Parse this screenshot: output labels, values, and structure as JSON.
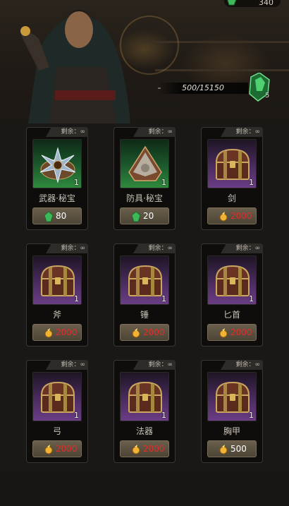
{
  "header": {
    "currency_amount": "340",
    "progress_text": "500/15150",
    "progress_fraction": 0.033,
    "progress_item_count": "5"
  },
  "shop": {
    "items": [
      {
        "remain": "剩余：∞",
        "qty": "1",
        "name": "武器·秘宝",
        "price": "80",
        "currency": "gem",
        "rarity": "green",
        "icon": "weapon-treasure-icon",
        "price_color": "white"
      },
      {
        "remain": "剩余：∞",
        "qty": "1",
        "name": "防具·秘宝",
        "price": "20",
        "currency": "gem",
        "rarity": "green",
        "icon": "armor-treasure-icon",
        "price_color": "white"
      },
      {
        "remain": "剩余：∞",
        "qty": "1",
        "name": "剑",
        "price": "2000",
        "currency": "gold",
        "rarity": "purple",
        "icon": "chest-icon",
        "price_color": "red"
      },
      {
        "remain": "剩余：∞",
        "qty": "1",
        "name": "斧",
        "price": "2000",
        "currency": "gold",
        "rarity": "purple",
        "icon": "chest-icon",
        "price_color": "red"
      },
      {
        "remain": "剩余：∞",
        "qty": "1",
        "name": "锤",
        "price": "2000",
        "currency": "gold",
        "rarity": "purple",
        "icon": "chest-icon",
        "price_color": "red"
      },
      {
        "remain": "剩余：∞",
        "qty": "1",
        "name": "匕首",
        "price": "2000",
        "currency": "gold",
        "rarity": "purple",
        "icon": "chest-icon",
        "price_color": "red"
      },
      {
        "remain": "剩余：∞",
        "qty": "1",
        "name": "弓",
        "price": "2000",
        "currency": "gold",
        "rarity": "purple",
        "icon": "chest-icon",
        "price_color": "red"
      },
      {
        "remain": "剩余：∞",
        "qty": "1",
        "name": "法器",
        "price": "2000",
        "currency": "gold",
        "rarity": "purple",
        "icon": "chest-icon",
        "price_color": "red"
      },
      {
        "remain": "剩余：∞",
        "qty": "1",
        "name": "胸甲",
        "price": "500",
        "currency": "gold",
        "rarity": "purple",
        "icon": "chest-icon",
        "price_color": "white"
      }
    ]
  },
  "colors": {
    "price_red": "#e52a2a",
    "gem_green": "#3fb85a",
    "gold": "#f2b233"
  }
}
